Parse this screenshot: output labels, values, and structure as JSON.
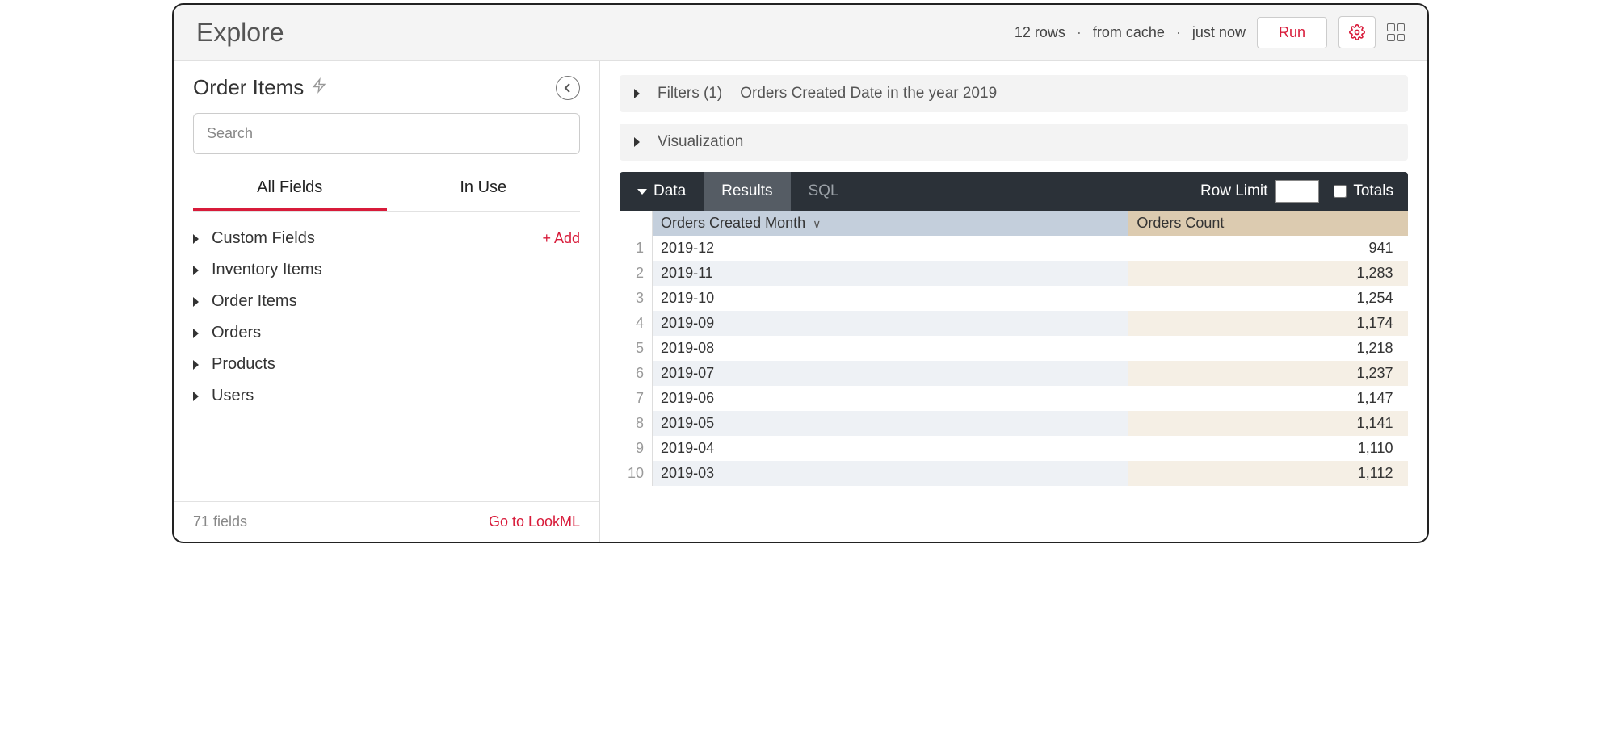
{
  "header": {
    "title": "Explore",
    "rows": "12 rows",
    "cache": "from cache",
    "time": "just now",
    "run": "Run"
  },
  "sidebar": {
    "title": "Order Items",
    "search_placeholder": "Search",
    "tabs": {
      "all": "All Fields",
      "inuse": "In Use"
    },
    "add": "+  Add",
    "groups": [
      {
        "label": "Custom Fields",
        "addable": true
      },
      {
        "label": "Inventory Items"
      },
      {
        "label": "Order Items"
      },
      {
        "label": "Orders"
      },
      {
        "label": "Products"
      },
      {
        "label": "Users"
      }
    ],
    "footer_count": "71 fields",
    "footer_link": "Go to LookML"
  },
  "main": {
    "filters_label": "Filters (1)",
    "filters_desc": "Orders Created Date in the year 2019",
    "viz_label": "Visualization",
    "data_label": "Data",
    "results_label": "Results",
    "sql_label": "SQL",
    "rowlimit_label": "Row Limit",
    "rowlimit_value": "",
    "totals_label": "Totals"
  },
  "table": {
    "col_dim": "Orders Created Month",
    "col_meas": "Orders Count",
    "rows": [
      {
        "n": "1",
        "month": "2019-12",
        "count": "941"
      },
      {
        "n": "2",
        "month": "2019-11",
        "count": "1,283"
      },
      {
        "n": "3",
        "month": "2019-10",
        "count": "1,254"
      },
      {
        "n": "4",
        "month": "2019-09",
        "count": "1,174"
      },
      {
        "n": "5",
        "month": "2019-08",
        "count": "1,218"
      },
      {
        "n": "6",
        "month": "2019-07",
        "count": "1,237"
      },
      {
        "n": "7",
        "month": "2019-06",
        "count": "1,147"
      },
      {
        "n": "8",
        "month": "2019-05",
        "count": "1,141"
      },
      {
        "n": "9",
        "month": "2019-04",
        "count": "1,110"
      },
      {
        "n": "10",
        "month": "2019-03",
        "count": "1,112"
      }
    ]
  }
}
